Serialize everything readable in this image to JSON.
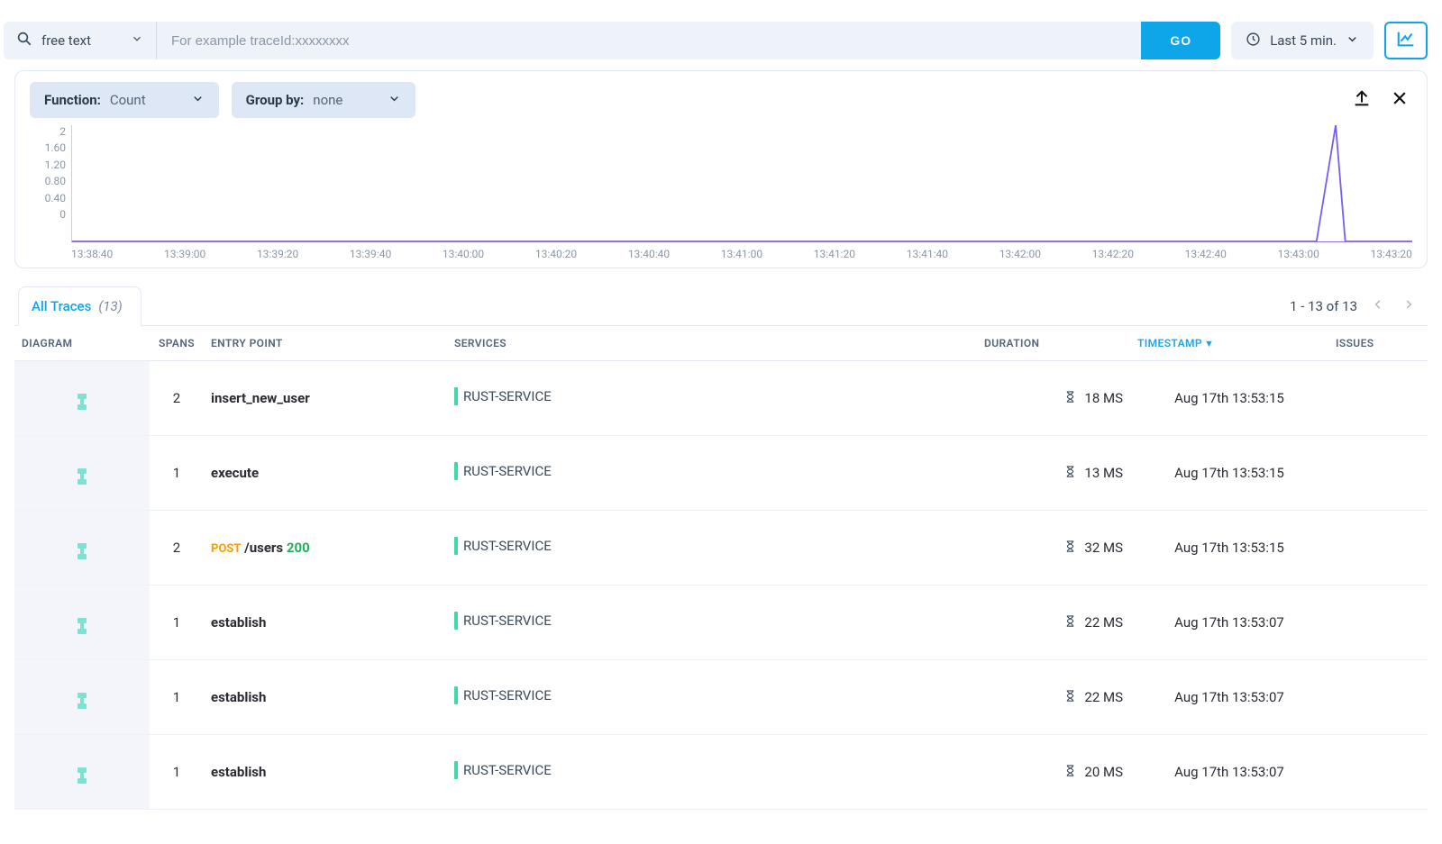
{
  "search": {
    "type_label": "free text",
    "placeholder": "For example traceId:xxxxxxxx",
    "value": "",
    "go_label": "GO"
  },
  "time_selector": {
    "label": "Last 5 min."
  },
  "chart_controls": {
    "function_label": "Function:",
    "function_value": "Count",
    "groupby_label": "Group by:",
    "groupby_value": "none"
  },
  "chart_data": {
    "type": "line",
    "title": "",
    "xlabel": "",
    "ylabel": "",
    "ylim": [
      0,
      2
    ],
    "y_ticks": [
      "2",
      "1.60",
      "1.20",
      "0.80",
      "0.40",
      "0"
    ],
    "x_ticks": [
      "13:38:40",
      "13:39:00",
      "13:39:20",
      "13:39:40",
      "13:40:00",
      "13:40:20",
      "13:40:40",
      "13:41:00",
      "13:41:20",
      "13:41:40",
      "13:42:00",
      "13:42:20",
      "13:42:40",
      "13:43:00",
      "13:43:20"
    ],
    "series": [
      {
        "name": "count",
        "color": "#7b5cf0",
        "points": [
          {
            "x": "13:38:40",
            "y": 0
          },
          {
            "x": "13:39:00",
            "y": 0
          },
          {
            "x": "13:39:20",
            "y": 0
          },
          {
            "x": "13:39:40",
            "y": 0
          },
          {
            "x": "13:40:00",
            "y": 0
          },
          {
            "x": "13:40:20",
            "y": 0
          },
          {
            "x": "13:40:40",
            "y": 0
          },
          {
            "x": "13:41:00",
            "y": 0
          },
          {
            "x": "13:41:20",
            "y": 0
          },
          {
            "x": "13:41:40",
            "y": 0
          },
          {
            "x": "13:42:00",
            "y": 0
          },
          {
            "x": "13:42:20",
            "y": 0
          },
          {
            "x": "13:42:40",
            "y": 0
          },
          {
            "x": "13:43:00",
            "y": 0
          },
          {
            "x": "13:43:04",
            "y": 2
          },
          {
            "x": "13:43:06",
            "y": 0
          },
          {
            "x": "13:43:20",
            "y": 0
          }
        ]
      }
    ]
  },
  "tabs": {
    "all_traces_label": "All Traces",
    "all_traces_count": "(13)"
  },
  "pagination": {
    "range": "1 - 13 of 13"
  },
  "table": {
    "headers": {
      "diagram": "DIAGRAM",
      "spans": "SPANS",
      "entry": "ENTRY POINT",
      "services": "SERVICES",
      "duration": "DURATION",
      "timestamp": "TIMESTAMP",
      "issues": "ISSUES"
    },
    "rows": [
      {
        "spans": "2",
        "entry": {
          "type": "plain",
          "text": "insert_new_user"
        },
        "service": "RUST-SERVICE",
        "duration": "18 MS",
        "timestamp": "Aug 17th 13:53:15"
      },
      {
        "spans": "1",
        "entry": {
          "type": "plain",
          "text": "execute"
        },
        "service": "RUST-SERVICE",
        "duration": "13 MS",
        "timestamp": "Aug 17th 13:53:15"
      },
      {
        "spans": "2",
        "entry": {
          "type": "http",
          "method": "POST",
          "path": "/users",
          "status": "200"
        },
        "service": "RUST-SERVICE",
        "duration": "32 MS",
        "timestamp": "Aug 17th 13:53:15"
      },
      {
        "spans": "1",
        "entry": {
          "type": "plain",
          "text": "establish"
        },
        "service": "RUST-SERVICE",
        "duration": "22 MS",
        "timestamp": "Aug 17th 13:53:07"
      },
      {
        "spans": "1",
        "entry": {
          "type": "plain",
          "text": "establish"
        },
        "service": "RUST-SERVICE",
        "duration": "22 MS",
        "timestamp": "Aug 17th 13:53:07"
      },
      {
        "spans": "1",
        "entry": {
          "type": "plain",
          "text": "establish"
        },
        "service": "RUST-SERVICE",
        "duration": "20 MS",
        "timestamp": "Aug 17th 13:53:07"
      }
    ]
  }
}
